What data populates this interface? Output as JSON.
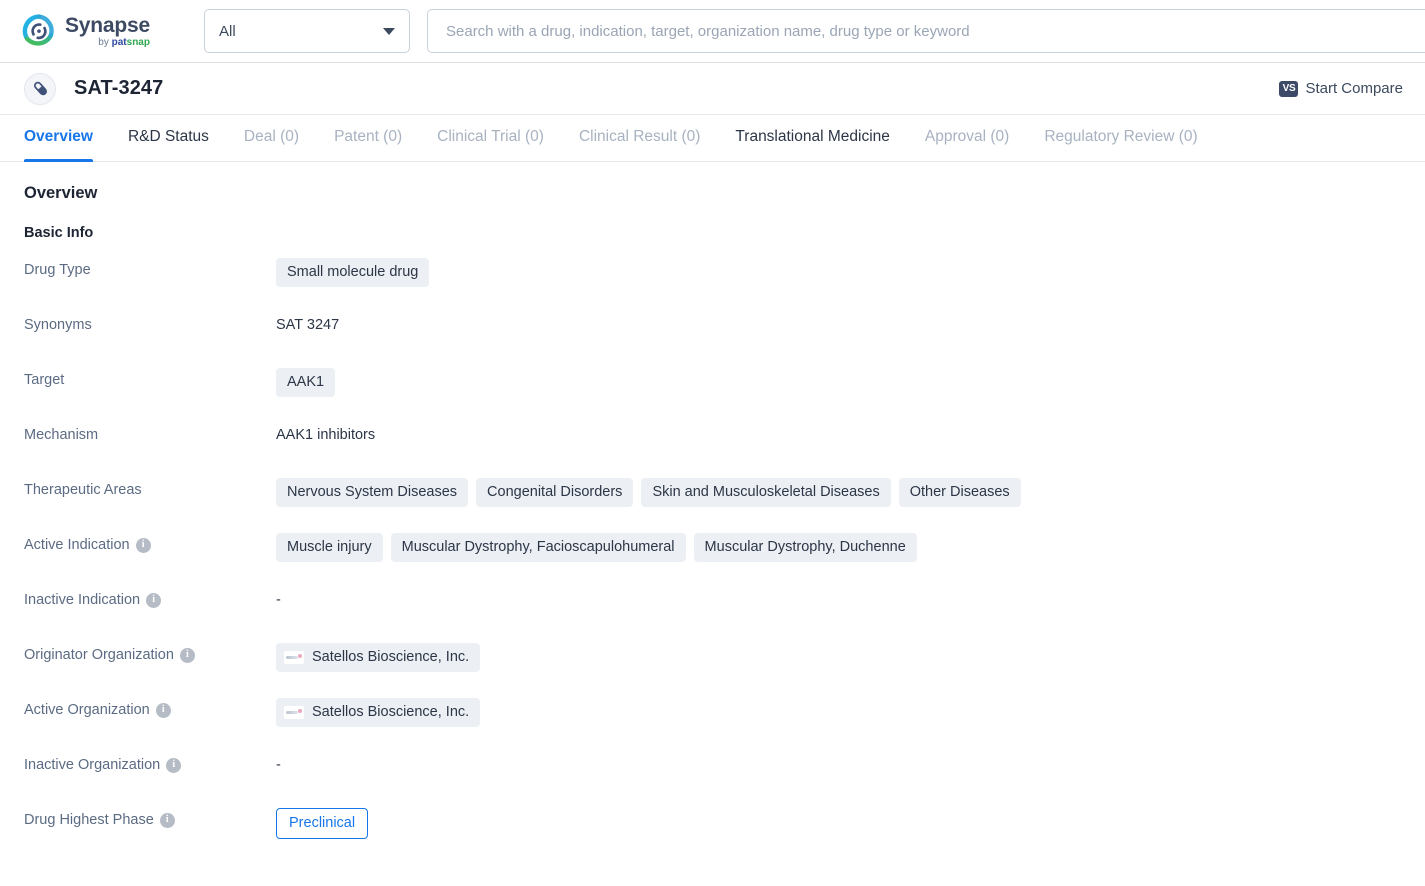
{
  "brand": {
    "name": "Synapse",
    "by": "by ",
    "pat": "pat",
    "snap": "snap"
  },
  "header": {
    "scope_value": "All",
    "search_placeholder": "Search with a drug, indication, target, organization name, drug type or keyword",
    "search_value": ""
  },
  "drug": {
    "title": "SAT-3247",
    "compare_label": "Start Compare",
    "vs_badge": "VS"
  },
  "tabs": [
    {
      "label": "Overview",
      "state": "active"
    },
    {
      "label": "R&D Status",
      "state": "enabled"
    },
    {
      "label": "Deal (0)",
      "state": "disabled"
    },
    {
      "label": "Patent (0)",
      "state": "disabled"
    },
    {
      "label": "Clinical Trial (0)",
      "state": "disabled"
    },
    {
      "label": "Clinical Result (0)",
      "state": "disabled"
    },
    {
      "label": "Translational Medicine",
      "state": "enabled"
    },
    {
      "label": "Approval (0)",
      "state": "disabled"
    },
    {
      "label": "Regulatory Review (0)",
      "state": "disabled"
    }
  ],
  "overview": {
    "section_title": "Overview",
    "subsection_title": "Basic Info",
    "rows": [
      {
        "label": "Drug Type",
        "info": false,
        "type": "tags",
        "values": [
          "Small molecule drug"
        ]
      },
      {
        "label": "Synonyms",
        "info": false,
        "type": "text",
        "values": [
          "SAT 3247"
        ]
      },
      {
        "label": "Target",
        "info": false,
        "type": "tags",
        "values": [
          "AAK1"
        ]
      },
      {
        "label": "Mechanism",
        "info": false,
        "type": "text",
        "values": [
          "AAK1 inhibitors"
        ]
      },
      {
        "label": "Therapeutic Areas",
        "info": false,
        "type": "tags",
        "values": [
          "Nervous System Diseases",
          "Congenital Disorders",
          "Skin and Musculoskeletal Diseases",
          "Other Diseases"
        ]
      },
      {
        "label": "Active Indication",
        "info": true,
        "type": "tags",
        "values": [
          "Muscle injury",
          "Muscular Dystrophy, Facioscapulohumeral",
          "Muscular Dystrophy, Duchenne"
        ]
      },
      {
        "label": "Inactive Indication",
        "info": true,
        "type": "dash",
        "values": [
          "-"
        ]
      },
      {
        "label": "Originator Organization",
        "info": true,
        "type": "org",
        "values": [
          "Satellos Bioscience, Inc."
        ]
      },
      {
        "label": "Active Organization",
        "info": true,
        "type": "org",
        "values": [
          "Satellos Bioscience, Inc."
        ]
      },
      {
        "label": "Inactive Organization",
        "info": true,
        "type": "dash",
        "values": [
          "-"
        ]
      },
      {
        "label": "Drug Highest Phase",
        "info": true,
        "type": "phase",
        "values": [
          "Preclinical"
        ]
      }
    ]
  },
  "colors": {
    "accent": "#1877e8",
    "tag_bg": "#eceff3",
    "label": "#5b6b83",
    "text": "#2c3647",
    "logo_blue": "#2aa9e0",
    "logo_green": "#3fb54a",
    "vs_badge_bg": "#3c4a68"
  },
  "info_icon_glyph": "i"
}
